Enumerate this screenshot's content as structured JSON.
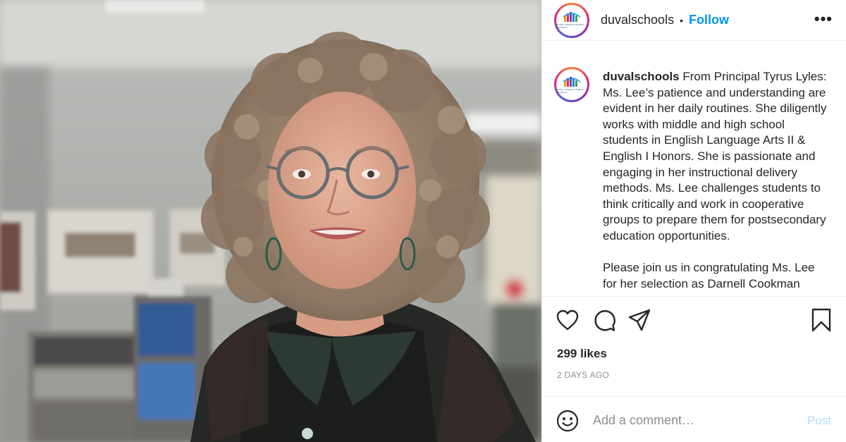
{
  "post": {
    "photo": {
      "icon": "portrait-photo"
    },
    "author": {
      "username": "duvalschools",
      "avatar_caption": "DUVAL COUNTY PUBLIC SCHOOLS",
      "separator": "•",
      "follow_label": "Follow",
      "more_icon": "more-options-icon",
      "more_label": "•••"
    },
    "caption": {
      "username": "duvalschools",
      "text": "From Principal Tyrus Lyles: Ms. Lee’s patience and understanding are evident in her daily routines. She diligently works with middle and high school students in English Language Arts II & English I Honors. She is passionate and engaging in her instructional delivery methods. Ms. Lee challenges students to think critically and work in cooperative groups to prepare them for postsecondary education opportunities.\n\nPlease join us in congratulating Ms. Lee for her selection as Darnell Cookman"
    },
    "actions": {
      "like_icon": "heart-icon",
      "comment_icon": "comment-icon",
      "share_icon": "share-icon",
      "save_icon": "bookmark-icon"
    },
    "likes": "299 likes",
    "timestamp": "2 DAYS AGO",
    "comment_box": {
      "emoji_icon": "emoji-icon",
      "placeholder": "Add a comment…",
      "value": "",
      "post_label": "Post",
      "post_color": "#b3dbff"
    }
  },
  "colors": {
    "accent": "#0095f6",
    "text": "#262626",
    "muted": "#8e8e8e",
    "border": "#efefef"
  }
}
